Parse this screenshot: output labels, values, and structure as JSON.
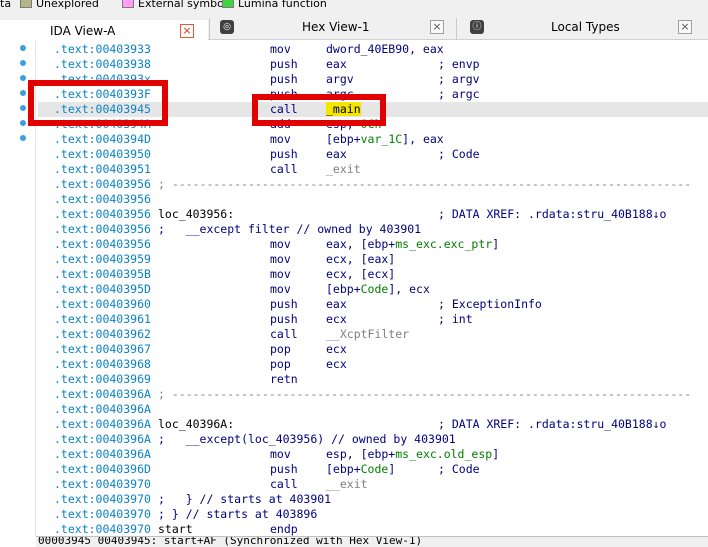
{
  "legend": {
    "items": [
      {
        "label": "ta",
        "color": ""
      },
      {
        "label": "Unexplored",
        "color": "#b5b589"
      },
      {
        "label": "External symbol",
        "color": "#ff9ef5"
      },
      {
        "label": "Lumina function",
        "color": "#3fd43f"
      }
    ]
  },
  "tabs": [
    {
      "label": "IDA View-A",
      "close": "×",
      "active": true
    },
    {
      "label": "Hex View-1",
      "close": "×",
      "active": false,
      "icon": "◎"
    },
    {
      "label": "Local Types",
      "close": "×",
      "active": false,
      "icon": "ⓘ"
    }
  ],
  "code": {
    "lines": [
      {
        "addr": ".text:00403933",
        "mn": "mov",
        "op": [
          [
            "dword_40EB90, eax",
            "blue"
          ]
        ],
        "cm": []
      },
      {
        "addr": ".text:00403938",
        "mn": "push",
        "op": [
          [
            "eax",
            "blue"
          ]
        ],
        "cm": [
          [
            "; envp",
            "blue"
          ]
        ]
      },
      {
        "addr": ".text:0040393x",
        "mn": "push",
        "op": [
          [
            "argv",
            "blue"
          ]
        ],
        "cm": [
          [
            "; argv",
            "blue"
          ]
        ]
      },
      {
        "addr": ".text:0040393F",
        "mn": "push",
        "op": [
          [
            "argc",
            "blue"
          ]
        ],
        "cm": [
          [
            "; argc",
            "blue"
          ]
        ]
      },
      {
        "addr": ".text:00403945",
        "mn": "call",
        "op": [
          [
            "_main",
            "hlyellow"
          ]
        ],
        "cm": [],
        "hl": true
      },
      {
        "addr": ".text:0040394A",
        "mn": "add",
        "op": [
          [
            "esp, ",
            "blue"
          ],
          [
            "0Ch",
            "green"
          ]
        ],
        "cm": []
      },
      {
        "addr": ".text:0040394D",
        "mn": "mov",
        "op": [
          [
            "[ebp+",
            "blue"
          ],
          [
            "var_1C",
            "green"
          ],
          [
            "], eax",
            "blue"
          ]
        ],
        "cm": []
      },
      {
        "addr": ".text:00403950",
        "mn": "push",
        "op": [
          [
            "eax",
            "blue"
          ]
        ],
        "cm": [
          [
            "; Code",
            "blue"
          ]
        ]
      },
      {
        "addr": ".text:00403951",
        "mn": "call",
        "op": [
          [
            "_exit",
            "grey"
          ]
        ],
        "cm": []
      },
      {
        "addr": ".text:00403956",
        "sep": "; ---------------------------------------------------------------------------"
      },
      {
        "addr": ".text:00403956"
      },
      {
        "addr": ".text:00403956",
        "lab": "loc_403956:",
        "cm": [
          [
            "; DATA XREF: .rdata:stru_40B188↓o",
            "blue"
          ]
        ]
      },
      {
        "addr": ".text:00403956",
        "full": ";   __except filter // owned by 403901"
      },
      {
        "addr": ".text:00403956",
        "mn": "mov",
        "op": [
          [
            "eax, [ebp+",
            "blue"
          ],
          [
            "ms_exc.exc_ptr",
            "green"
          ],
          [
            "]",
            "blue"
          ]
        ],
        "cm": []
      },
      {
        "addr": ".text:00403959",
        "mn": "mov",
        "op": [
          [
            "ecx, [eax]",
            "blue"
          ]
        ],
        "cm": []
      },
      {
        "addr": ".text:0040395B",
        "mn": "mov",
        "op": [
          [
            "ecx, [ecx]",
            "blue"
          ]
        ],
        "cm": []
      },
      {
        "addr": ".text:0040395D",
        "mn": "mov",
        "op": [
          [
            "[ebp+",
            "blue"
          ],
          [
            "Code",
            "green"
          ],
          [
            "], ecx",
            "blue"
          ]
        ],
        "cm": []
      },
      {
        "addr": ".text:00403960",
        "mn": "push",
        "op": [
          [
            "eax",
            "blue"
          ]
        ],
        "cm": [
          [
            "; ExceptionInfo",
            "blue"
          ]
        ]
      },
      {
        "addr": ".text:00403961",
        "mn": "push",
        "op": [
          [
            "ecx",
            "blue"
          ]
        ],
        "cm": [
          [
            "; int",
            "blue"
          ]
        ]
      },
      {
        "addr": ".text:00403962",
        "mn": "call",
        "op": [
          [
            "__XcptFilter",
            "grey"
          ]
        ],
        "cm": []
      },
      {
        "addr": ".text:00403967",
        "mn": "pop",
        "op": [
          [
            "ecx",
            "blue"
          ]
        ],
        "cm": []
      },
      {
        "addr": ".text:00403968",
        "mn": "pop",
        "op": [
          [
            "ecx",
            "blue"
          ]
        ],
        "cm": []
      },
      {
        "addr": ".text:00403969",
        "mn": "retn",
        "op": [],
        "cm": []
      },
      {
        "addr": ".text:0040396A",
        "sep": "; ---------------------------------------------------------------------------"
      },
      {
        "addr": ".text:0040396A"
      },
      {
        "addr": ".text:0040396A",
        "lab": "loc_40396A:",
        "cm": [
          [
            "; DATA XREF: .rdata:stru_40B188↓o",
            "blue"
          ]
        ]
      },
      {
        "addr": ".text:0040396A",
        "full": ";   __except(loc_403956) // owned by 403901"
      },
      {
        "addr": ".text:0040396A",
        "mn": "mov",
        "op": [
          [
            "esp, [ebp+",
            "blue"
          ],
          [
            "ms_exc.old_esp",
            "green"
          ],
          [
            "]",
            "blue"
          ]
        ],
        "cm": []
      },
      {
        "addr": ".text:0040396D",
        "mn": "push",
        "op": [
          [
            "[ebp+",
            "blue"
          ],
          [
            "Code",
            "green"
          ],
          [
            "]",
            "blue"
          ]
        ],
        "cm": [
          [
            "; Code",
            "blue"
          ]
        ]
      },
      {
        "addr": ".text:00403970",
        "mn": "call",
        "op": [
          [
            "__exit",
            "grey"
          ]
        ],
        "cm": []
      },
      {
        "addr": ".text:00403970",
        "full": ";   } // starts at 403901"
      },
      {
        "addr": ".text:00403970",
        "full": "; } // starts at 403896"
      },
      {
        "addr": ".text:00403970",
        "lab": "start",
        "mn": "endp",
        "op": [],
        "cm": []
      }
    ]
  },
  "status": {
    "text": "00003945 00403945: start+AF (Synchronized with Hex View-1)"
  }
}
